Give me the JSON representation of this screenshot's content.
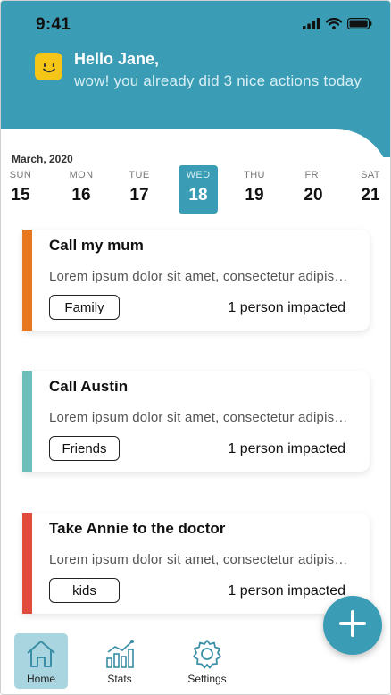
{
  "status_bar": {
    "time": "9:41"
  },
  "header": {
    "greeting": "Hello Jane,",
    "subtitle": "wow! you already did 3 nice actions today"
  },
  "calendar": {
    "month": "March, 2020",
    "days": [
      {
        "name": "SUN",
        "date": "15",
        "active": false
      },
      {
        "name": "MON",
        "date": "16",
        "active": false
      },
      {
        "name": "TUE",
        "date": "17",
        "active": false
      },
      {
        "name": "WED",
        "date": "18",
        "active": true
      },
      {
        "name": "THU",
        "date": "19",
        "active": false
      },
      {
        "name": "FRI",
        "date": "20",
        "active": false
      },
      {
        "name": "SAT",
        "date": "21",
        "active": false
      }
    ]
  },
  "actions": [
    {
      "title": "Call my mum",
      "description": "Lorem ipsum dolor sit amet, consectetur adipiscing",
      "tag": "Family",
      "impact": "1 person impacted",
      "color": "#e8781f"
    },
    {
      "title": "Call Austin",
      "description": "Lorem ipsum dolor sit amet, consectetur adipiscing",
      "tag": "Friends",
      "impact": "1 person impacted",
      "color": "#6bbfb8"
    },
    {
      "title": "Take Annie to the doctor",
      "description": "Lorem ipsum dolor sit amet, consectetur adipiscing",
      "tag": "kids",
      "impact": "1 person impacted",
      "color": "#e04b3c"
    }
  ],
  "tabs": [
    {
      "label": "Home",
      "icon": "home-icon",
      "active": true
    },
    {
      "label": "Stats",
      "icon": "stats-icon",
      "active": false
    },
    {
      "label": "Settings",
      "icon": "gear-icon",
      "active": false
    }
  ],
  "fab": {
    "icon": "plus-icon"
  },
  "colors": {
    "primary": "#3a9db5",
    "smiley": "#f5c518"
  }
}
